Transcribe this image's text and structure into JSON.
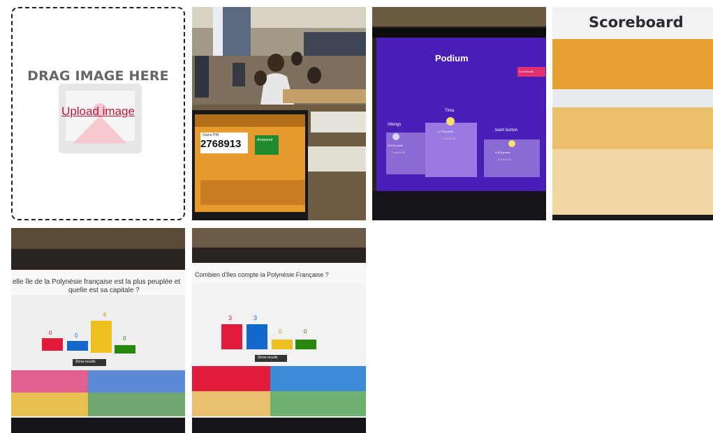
{
  "dropzone": {
    "title": "DRAG IMAGE HERE",
    "upload_label": "Upload image"
  },
  "photo1": {
    "pin_label": "Game PIN",
    "pin": "2768913",
    "answered": "Answered"
  },
  "photo2": {
    "title": "Podium",
    "button": "Get Results",
    "teams": [
      {
        "name": "Vikings",
        "points": "6,578 points",
        "sub": "7 out of 10"
      },
      {
        "name": "Tima",
        "points": "8,778 points",
        "sub": "7 out of 10"
      },
      {
        "name": "team burton",
        "points": "5,878 points",
        "sub": "6 out of 10"
      }
    ]
  },
  "photo3": {
    "title": "Scoreboard"
  },
  "photo4": {
    "question_line1": "elle île de la Polynésie française est la plus peuplée et",
    "question_line2": "quelle est sa capitale ?",
    "counts": [
      "0",
      "0",
      "6",
      "0"
    ],
    "show_results": "Show results"
  },
  "photo5": {
    "question": "Combien d'îles compte la Polynésie Française ?",
    "counts": [
      "3",
      "3",
      "0",
      "0"
    ],
    "show_results": "Show results"
  },
  "colors": {
    "kahoot_red": "#e21b3c",
    "kahoot_blue": "#1368ce",
    "kahoot_yellow": "#d89e00",
    "kahoot_green": "#26890c",
    "podium_purple": "#4a1fb8",
    "scoreboard_orange": "#e8a030",
    "upload_link": "#c0183b"
  }
}
